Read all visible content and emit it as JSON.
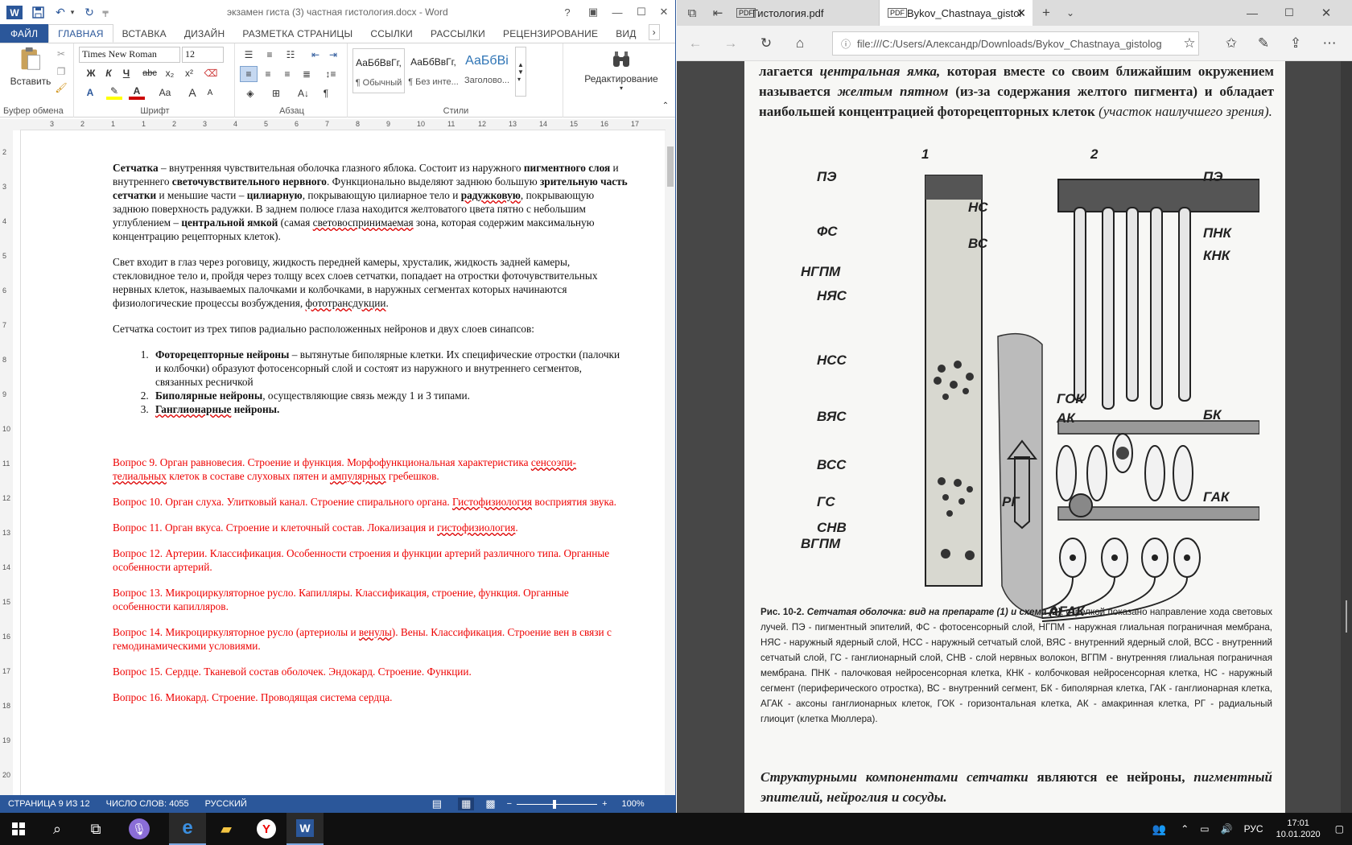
{
  "word": {
    "title": "экзамен гиста (3) частная гистология.docx - Word",
    "tabs": [
      "ФАЙЛ",
      "ГЛАВНАЯ",
      "ВСТАВКА",
      "ДИЗАЙН",
      "РАЗМЕТКА СТРАНИЦЫ",
      "ССЫЛКИ",
      "РАССЫЛКИ",
      "РЕЦЕНЗИРОВАНИЕ",
      "ВИД"
    ],
    "ribbon": {
      "paste": "Вставить",
      "clipboard": "Буфер обмена",
      "font_name": "Times New Roman",
      "font_size": "12",
      "font_group": "Шрифт",
      "para_group": "Абзац",
      "styles_group": "Стили",
      "edit": "Редактирование",
      "styles": [
        {
          "preview": "АаБбВвГг,",
          "name": "¶ Обычный"
        },
        {
          "preview": "АаБбВвГг,",
          "name": "¶ Без инте..."
        },
        {
          "preview": "АаБбВі",
          "name": "Заголово..."
        }
      ],
      "bold": "Ж",
      "italic": "К",
      "underline": "Ч",
      "strike": "abc",
      "sub": "x₂",
      "sup": "x²",
      "aa": "Aa",
      "grow": "A",
      "shrink": "A"
    },
    "ruler": [
      "3",
      "2",
      "1",
      "1",
      "2",
      "3",
      "4",
      "5",
      "6",
      "7",
      "8",
      "9",
      "10",
      "11",
      "12",
      "13",
      "14",
      "15",
      "16",
      "17"
    ],
    "vruler": [
      "2",
      "3",
      "4",
      "5",
      "6",
      "7",
      "8",
      "9",
      "10",
      "11",
      "12",
      "13",
      "14",
      "15",
      "16",
      "17",
      "18",
      "19",
      "20"
    ],
    "doc": {
      "p1": {
        "a": "Сетчатка",
        "b": " – внутренняя чувствительная оболочка глазного яблока. Состоит из наружного ",
        "c": "пигментного слоя",
        "d": " и внутреннего ",
        "e": "светочувствительного нервного",
        "f": ". Функционально выделяют заднюю большую ",
        "g": "зрительную часть сетчатки",
        "h": " и меньшие части – ",
        "i": "цилиарную",
        "j": ", покрывающую цилиарное тело и ",
        "k": "радужковую",
        "l": ", покрывающую заднюю поверхность радужки. В заднем полюсе глаза находится желтоватого цвета пятно с небольшим углублением – ",
        "m": "центральной ямкой",
        "n": " (самая ",
        "o": "световоспринимаемая",
        "q": " зона, которая содержим максимальную концентрацию рецепторных клеток)."
      },
      "p2": {
        "a": "Свет входит в глаз через роговицу, жидкость передней камеры, хрусталик, жидкость задней камеры, стекловидное тело и, пройдя через толщу всех слоев сетчатки, попадает на отростки фоточувствительных нервных клеток, называемых палочками и колбочками, в наружных сегментах которых начинаются физиологические процессы возбуждения, ",
        "b": "фототрансдукции",
        "c": "."
      },
      "p3": "Сетчатка состоит из трех типов радиально расположенных нейронов и двух слоев синапсов:",
      "list": [
        {
          "bold": "Фоторецепторные нейроны",
          "text": " – вытянутые биполярные клетки. Их специфические отростки (палочки и колбочки) образуют фотосенсорный слой и состоят из наружного и внутреннего сегментов, связанных ресничкой"
        },
        {
          "bold": "Биполярные нейроны",
          "text": ", осуществляющие связь между 1 и 3 типами."
        },
        {
          "bold": "Ганглионарные",
          "text": " нейроны."
        }
      ],
      "q9": {
        "a": "Вопрос 9. Орган равновесия. Строение и функция. Морфофункциональная характеристика ",
        "b": "сенсоэпи-телиальных",
        "c": " клеток в составе слуховых пятен и ",
        "d": "ампулярных",
        "e": " гребешков."
      },
      "q10": {
        "a": "Вопрос 10. Орган слуха. Улитковый канал. Строение спирального органа. ",
        "b": "Гистофизиология",
        "c": " восприятия звука."
      },
      "q11": {
        "a": "Вопрос 11. Орган вкуса. Строение и клеточный состав. Локализация и ",
        "b": "гистофизиология",
        "c": "."
      },
      "q12": "Вопрос 12. Артерии. Классификация. Особенности строения и функции артерий различного типа. Органные особенности артерий.",
      "q13": "Вопрос 13. Микроциркуляторное русло. Капилляры. Классификация, строение, функция. Органные особенности капилляров.",
      "q14": {
        "a": "Вопрос 14. Микроциркуляторное русло (артериолы и ",
        "b": "венулы",
        "c": "). Вены. Классификация. Строение вен в связи с гемодинамическими условиями."
      },
      "q15": "Вопрос 15. Сердце. Тканевой состав оболочек. Эндокард. Строение. Функции.",
      "q16": "Вопрос 16. Миокард. Строение. Проводящая система сердца."
    },
    "status": {
      "page": "СТРАНИЦА 9 ИЗ 12",
      "words": "ЧИСЛО СЛОВ: 4055",
      "lang": "РУССКИЙ",
      "zoom": "100%"
    },
    "zoom_fraction": 0.47
  },
  "edge": {
    "tabs": [
      {
        "label": "Гистология.pdf"
      },
      {
        "label": "Bykov_Chastnaya_gistol"
      }
    ],
    "url": "file:///C:/Users/Александр/Downloads/Bykov_Chastnaya_gistolog",
    "pdf": {
      "top": {
        "a": "лагается ",
        "b": "центральная ямка,",
        "c": " которая вместе со своим ближайшим окружением называется ",
        "d": "желтым пятном",
        "e": " (из-за содержания желтого пигмента) и обладает наибольшей концентрацией фоторецепторных клеток ",
        "f": "(участок наилучшего зрения)."
      },
      "fig": {
        "n1": "1",
        "n2": "2",
        "left": [
          "ПЭ",
          "ФС",
          "НГПМ",
          "НЯС",
          "НСС",
          "ВЯС",
          "ВСС",
          "ГС",
          "СНВ",
          "ВГПМ"
        ],
        "right": [
          "ПЭ",
          "ПНК",
          "КНК",
          "БК",
          "ГАК"
        ],
        "mid": [
          "НС",
          "ВС",
          "ГОК",
          "АК",
          "РГ"
        ],
        "bottom": "АГАК"
      },
      "caption": {
        "a": "Рис. 10-2. ",
        "b": "Сетчатая оболочка: вид на препарате (1) и схема (2)",
        "c": "; стрелкой показано направление хода световых лучей. ПЭ - пигментный эпителий, ФС - фотосенсорный слой, НГПМ - наружная глиальная пограничная мембрана, НЯС - наружный ядерный слой, НСС - наружный сетчатый слой, ВЯС - внутренний ядерный слой, ВСС - внутренний сетчатый слой, ГС - ганглионарный слой, СНВ - слой нервных волокон, ВГПМ - внутренняя глиальная пограничная мембрана. ПНК - палочковая нейросенсорная клетка, КНК - колбочковая нейросенсорная клетка, НС - наружный сегмент (периферического отростка), ВС - внутренний сегмент, БК - биполярная клетка, ГАК - ганглионарная клетка, АГАК - аксоны ганглионарных клеток, ГОК - горизонтальная клетка, АК - амакринная клетка, РГ - радиальный глиоцит (клетка Мюллера)."
      },
      "bottom": {
        "a": "Структурными компонентами сетчатки",
        "b": " являются ее ",
        "c": "нейроны,",
        "d": " пигментный эпителий, нейроглия и сосуды."
      }
    }
  },
  "taskbar": {
    "lang": "РУС",
    "time": "17:01",
    "date": "10.01.2020"
  },
  "colors": {
    "word_blue": "#2b579a",
    "question_red": "#e00000",
    "taskbar": "#101010"
  }
}
